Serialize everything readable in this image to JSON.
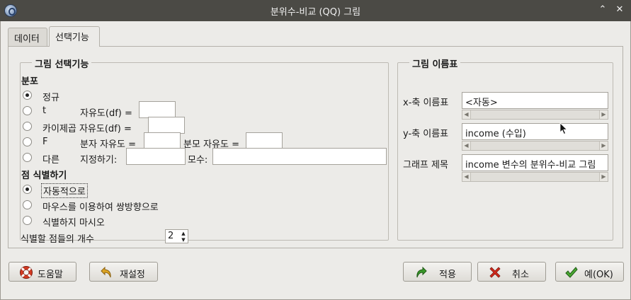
{
  "window": {
    "title": "분위수-비교 (QQ) 그림",
    "minimize_glyph": "⌃",
    "close_glyph": "✕"
  },
  "tabs": [
    {
      "label": "데이터",
      "active": false
    },
    {
      "label": "선택기능",
      "active": true
    }
  ],
  "options_group": {
    "legend": "그림 선택기능",
    "distribution": {
      "heading": "분포",
      "normal_label": "정규",
      "t_label": "t",
      "t_df_label": "자유도(df) =",
      "t_df_value": "",
      "chisq_label": "카이제곱 자유도(df) =",
      "chisq_df_value": "",
      "f_label": "F",
      "f_num_df_label": "분자 자유도 =",
      "f_num_df_value": "",
      "f_den_df_label": "분모 자유도 =",
      "f_den_df_value": "",
      "other_label": "다른",
      "other_spec_label": "지정하기:",
      "other_spec_value": "",
      "params_label": "모수:",
      "params_value": "",
      "selected": "정규"
    },
    "identify": {
      "heading": "점 식별하기",
      "auto_label": "자동적으로",
      "mouse_label": "마우스를 이용하여 쌍방향으로",
      "none_label": "식별하지 마시오",
      "selected": "자동적으로",
      "count_label": "식별할 점들의 개수",
      "count_value": "2"
    }
  },
  "labels_group": {
    "legend": "그림 이름표",
    "xlab_label": "x-축 이름표",
    "xlab_value": "<자동>",
    "ylab_label": "y-축 이름표",
    "ylab_value": "income (수입)",
    "title_label": "그래프 제목",
    "title_value": "income 변수의 분위수-비교 그림"
  },
  "buttons": {
    "help": "도움말",
    "reset": "재설정",
    "apply": "적용",
    "cancel": "취소",
    "ok": "예(OK)"
  },
  "colors": {
    "titlebar": "#4b4a45",
    "window_bg": "#ecebe8",
    "apply_arrow": "#3a9a2a",
    "cancel_x": "#d42a1c",
    "ok_check": "#3a9a2a",
    "reset_arrow": "#d8a21c"
  }
}
